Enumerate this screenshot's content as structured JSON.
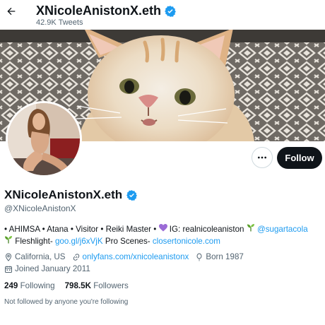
{
  "header": {
    "title": "XNicoleAnistonX.eth",
    "tweets_count": "42.9K Tweets",
    "back_icon": "arrow-left-icon",
    "verified_icon": "verified-badge-icon"
  },
  "profile": {
    "display_name": "XNicoleAnistonX.eth",
    "handle": "@XNicoleAnistonX",
    "follow_label": "Follow",
    "more_icon": "more-options-icon"
  },
  "bio": {
    "line1_text": "• AHIMSA • Atana • Visitor • Reiki Master • ",
    "line1_text2": " IG: realnicoleaniston ",
    "line1_link": "@sugartacola",
    "line2_text1": "Fleshlight- ",
    "line2_link1": "goo.gl/j6xVjK",
    "line2_text2": "  Pro Scenes- ",
    "line2_link2": "closertonicole.com"
  },
  "meta": {
    "location": "California, US",
    "website": "onlyfans.com/xnicoleanistonx",
    "born": "Born 1987",
    "joined": "Joined January 2011"
  },
  "stats": {
    "following_count": "249",
    "following_label": "Following",
    "followers_count": "798.5K",
    "followers_label": "Followers"
  },
  "footer": {
    "not_followed": "Not followed by anyone you're following"
  },
  "colors": {
    "accent": "#1d9bf0",
    "text": "#0f1419",
    "secondary": "#536471",
    "follow_bg": "#0f1419",
    "heart": "#9b6bd6",
    "seedling": "#5aa02c"
  }
}
